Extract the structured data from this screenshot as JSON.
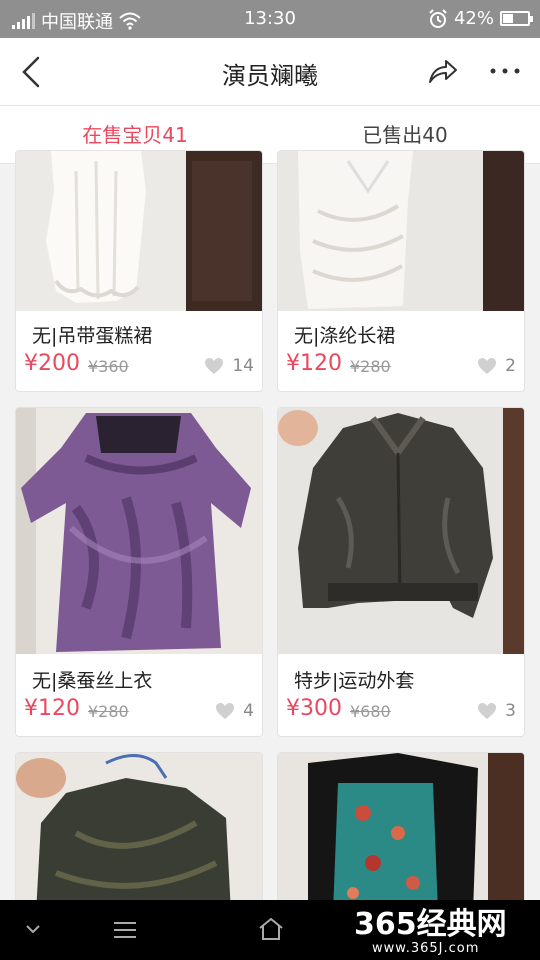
{
  "status_bar": {
    "carrier": "中国联通",
    "time": "13:30",
    "battery": "42%",
    "battery_level": 0.42
  },
  "header": {
    "title": "演员斓曦",
    "icons": [
      "back-arrow-icon",
      "share-icon",
      "more-icon"
    ]
  },
  "tabs": [
    {
      "label": "在售宝贝41",
      "active": true
    },
    {
      "label": "已售出40",
      "active": false
    }
  ],
  "products": [
    {
      "name": "无|吊带蛋糕裙",
      "price": "¥200",
      "original_price": "¥360",
      "likes": "14"
    },
    {
      "name": "无|涤纶长裙",
      "price": "¥120",
      "original_price": "¥280",
      "likes": "2"
    },
    {
      "name": "无|桑蚕丝上衣",
      "price": "¥120",
      "original_price": "¥280",
      "likes": "4"
    },
    {
      "name": "特步|运动外套",
      "price": "¥300",
      "original_price": "¥680",
      "likes": "3"
    },
    {
      "name": "",
      "price": "",
      "original_price": "",
      "likes": ""
    },
    {
      "name": "",
      "price": "",
      "original_price": "",
      "likes": ""
    }
  ],
  "watermark": {
    "brand": "365经典网",
    "url": "www.365J.com"
  },
  "colors": {
    "accent": "#e9495e",
    "status_bar": "#8f8f8f",
    "system_bar": "#000000"
  }
}
